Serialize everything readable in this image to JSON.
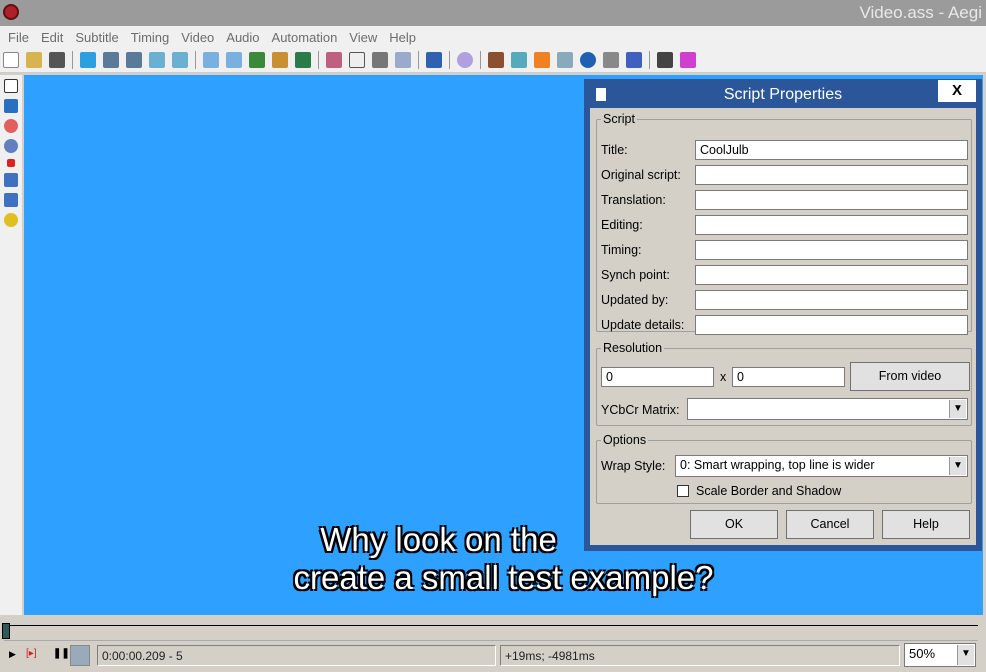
{
  "window": {
    "title": "Video.ass - Aegi"
  },
  "menu": [
    "File",
    "Edit",
    "Subtitle",
    "Timing",
    "Video",
    "Audio",
    "Automation",
    "View",
    "Help"
  ],
  "video": {
    "subtitle_line1": "Why look on the",
    "subtitle_line2": "create a small test example?"
  },
  "status": {
    "time": "0:00:00.209 - 5",
    "offset": "+19ms; -4981ms",
    "zoom": "50%"
  },
  "dialog": {
    "title": "Script Properties",
    "close": "X",
    "script_legend": "Script",
    "fields": [
      {
        "label": "Title:",
        "value": "CoolJulb"
      },
      {
        "label": "Original script:",
        "value": ""
      },
      {
        "label": "Translation:",
        "value": ""
      },
      {
        "label": "Editing:",
        "value": ""
      },
      {
        "label": "Timing:",
        "value": ""
      },
      {
        "label": "Synch point:",
        "value": ""
      },
      {
        "label": "Updated by:",
        "value": ""
      },
      {
        "label": "Update details:",
        "value": ""
      }
    ],
    "resolution_legend": "Resolution",
    "res_x": "0",
    "res_sep": "x",
    "res_y": "0",
    "from_video": "From video",
    "ycbcr_label": "YCbCr Matrix:",
    "ycbcr_value": "",
    "options_legend": "Options",
    "wrap_label": "Wrap Style:",
    "wrap_value": "0: Smart wrapping, top line is wider",
    "scale_label": "Scale Border and Shadow",
    "ok": "OK",
    "cancel": "Cancel",
    "help": "Help"
  }
}
